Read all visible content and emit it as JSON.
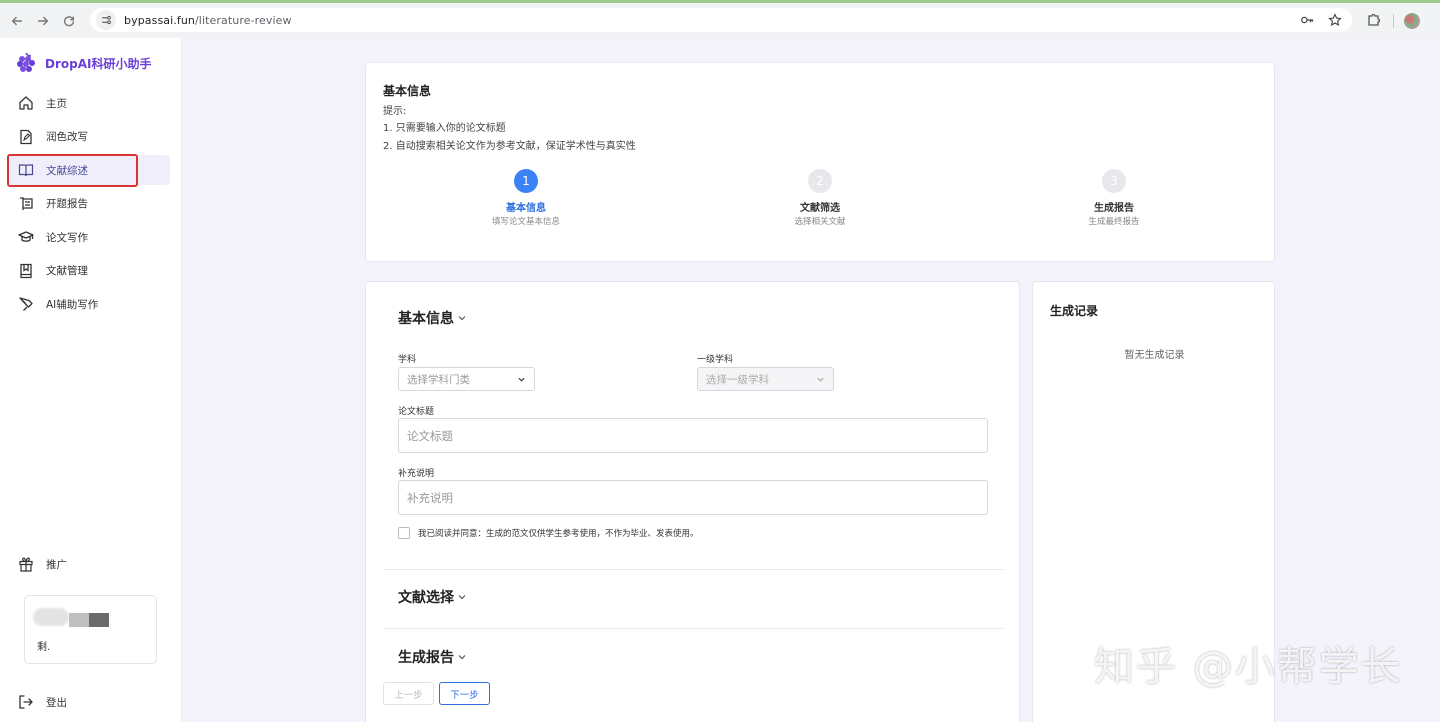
{
  "browser": {
    "url_host": "bypassai.fun",
    "url_path": "/literature-review"
  },
  "sidebar": {
    "brand": "DropAI科研小助手",
    "items": [
      {
        "label": "主页",
        "icon": "home-icon"
      },
      {
        "label": "润色改写",
        "icon": "document-edit-icon"
      },
      {
        "label": "文献综述",
        "icon": "book-open-icon",
        "active": true
      },
      {
        "label": "开题报告",
        "icon": "report-icon"
      },
      {
        "label": "论文写作",
        "icon": "graduation-cap-icon"
      },
      {
        "label": "文献管理",
        "icon": "bookmark-icon"
      },
      {
        "label": "AI辅助写作",
        "icon": "pen-icon"
      }
    ],
    "promo": "推广",
    "user_remaining": "剩.",
    "logout": "登出"
  },
  "info": {
    "title": "基本信息",
    "hint_label": "提示:",
    "hint_1": "1. 只需要输入你的论文标题",
    "hint_2": "2. 自动搜索相关论文作为参考文献，保证学术性与真实性",
    "steps": [
      {
        "number": "1",
        "title": "基本信息",
        "subtitle": "填写论文基本信息"
      },
      {
        "number": "2",
        "title": "文献筛选",
        "subtitle": "选择相关文献"
      },
      {
        "number": "3",
        "title": "生成报告",
        "subtitle": "生成最终报告"
      }
    ],
    "current_step": 1
  },
  "form": {
    "section_basic": "基本信息",
    "subject_label": "学科",
    "subject_placeholder": "选择学科门类",
    "level1_label": "一级学科",
    "level1_placeholder": "选择一级学科",
    "title_label": "论文标题",
    "title_placeholder": "论文标题",
    "note_label": "补充说明",
    "note_placeholder": "补充说明",
    "agree_text": "我已阅读并同意：生成的范文仅供学生参考使用，不作为毕业、发表使用。",
    "section_literature": "文献选择",
    "section_report": "生成报告",
    "prev_button": "上一步",
    "next_button": "下一步"
  },
  "records": {
    "title": "生成记录",
    "empty": "暂无生成记录"
  },
  "watermark": "知乎 @小帮学长",
  "colors": {
    "brand": "#6a3fd8",
    "primary": "#3b82f6",
    "highlight": "#d93434"
  }
}
